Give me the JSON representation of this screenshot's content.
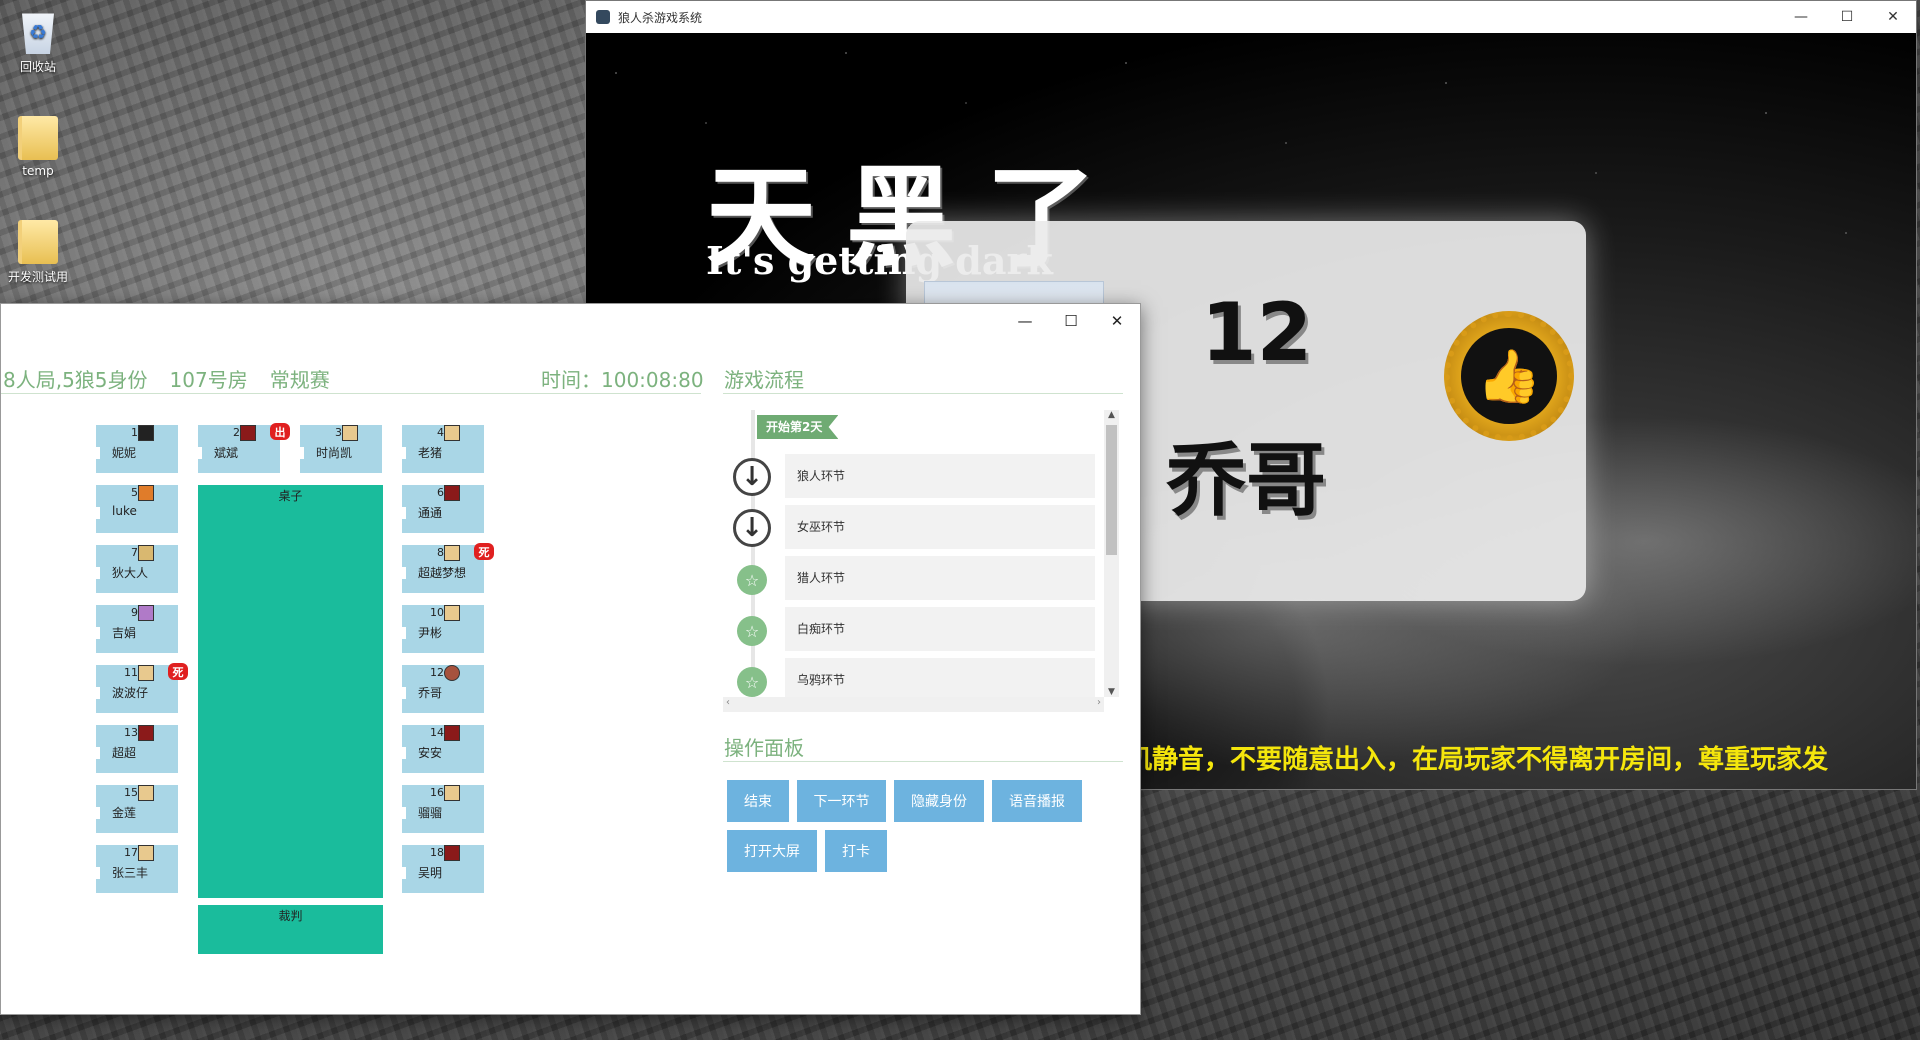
{
  "desktop": {
    "icons": [
      {
        "label": "回收站",
        "icon": "recycle-bin-icon"
      },
      {
        "label": "temp",
        "icon": "folder-icon"
      },
      {
        "label": "开发测试用",
        "icon": "folder-icon"
      }
    ]
  },
  "game_window": {
    "title": "狼人杀游戏系统",
    "heading": "天黑了",
    "subheading": "It's getting dark",
    "announce": {
      "seat_number": "12",
      "player_name": "乔哥",
      "medal_icon": "thumbs-up-medal-icon"
    },
    "marquee": "机静音，不要随意出入，在局玩家不得离开房间，尊重玩家发"
  },
  "admin_window": {
    "room_info": {
      "mode": "8人局,5狼5身份",
      "room": "107号房",
      "match_type": "常规赛",
      "time_label": "时间：100:08:80"
    },
    "table_label": "桌子",
    "judge_label": "裁判",
    "seats": [
      {
        "num": "1",
        "name": "妮妮",
        "badge": "b-dark",
        "flag": ""
      },
      {
        "num": "2",
        "name": "斌斌",
        "badge": "b-red",
        "flag": "出"
      },
      {
        "num": "3",
        "name": "时尚凯",
        "badge": "",
        "flag": ""
      },
      {
        "num": "4",
        "name": "老猪",
        "badge": "",
        "flag": ""
      },
      {
        "num": "5",
        "name": "luke",
        "badge": "b-orange",
        "flag": ""
      },
      {
        "num": "6",
        "name": "通通",
        "badge": "b-red",
        "flag": ""
      },
      {
        "num": "7",
        "name": "狄大人",
        "badge": "b-eye",
        "flag": ""
      },
      {
        "num": "8",
        "name": "超越梦想",
        "badge": "",
        "flag": "死"
      },
      {
        "num": "9",
        "name": "吉娟",
        "badge": "b-purple",
        "flag": ""
      },
      {
        "num": "10",
        "name": "尹彬",
        "badge": "",
        "flag": ""
      },
      {
        "num": "11",
        "name": "波波仔",
        "badge": "",
        "flag": "死"
      },
      {
        "num": "12",
        "name": "乔哥",
        "badge": "b-brown",
        "flag": ""
      },
      {
        "num": "13",
        "name": "超超",
        "badge": "b-red",
        "flag": ""
      },
      {
        "num": "14",
        "name": "安安",
        "badge": "b-red",
        "flag": ""
      },
      {
        "num": "15",
        "name": "金莲",
        "badge": "",
        "flag": ""
      },
      {
        "num": "16",
        "name": "骝骝",
        "badge": "",
        "flag": ""
      },
      {
        "num": "17",
        "name": "张三丰",
        "badge": "",
        "flag": ""
      },
      {
        "num": "18",
        "name": "吴明",
        "badge": "b-red",
        "flag": ""
      }
    ],
    "flow": {
      "title": "游戏流程",
      "tag": "开始第2天",
      "steps": [
        {
          "label": "狼人环节",
          "marker": "down-arrow-icon"
        },
        {
          "label": "女巫环节",
          "marker": "down-arrow-icon"
        },
        {
          "label": "猎人环节",
          "marker": "star-icon"
        },
        {
          "label": "白痴环节",
          "marker": "star-icon"
        },
        {
          "label": "乌鸦环节",
          "marker": "star-icon"
        }
      ]
    },
    "ops": {
      "title": "操作面板",
      "buttons": [
        "结束",
        "下一环节",
        "隐藏身份",
        "语音播报",
        "打开大屏",
        "打卡"
      ]
    }
  }
}
